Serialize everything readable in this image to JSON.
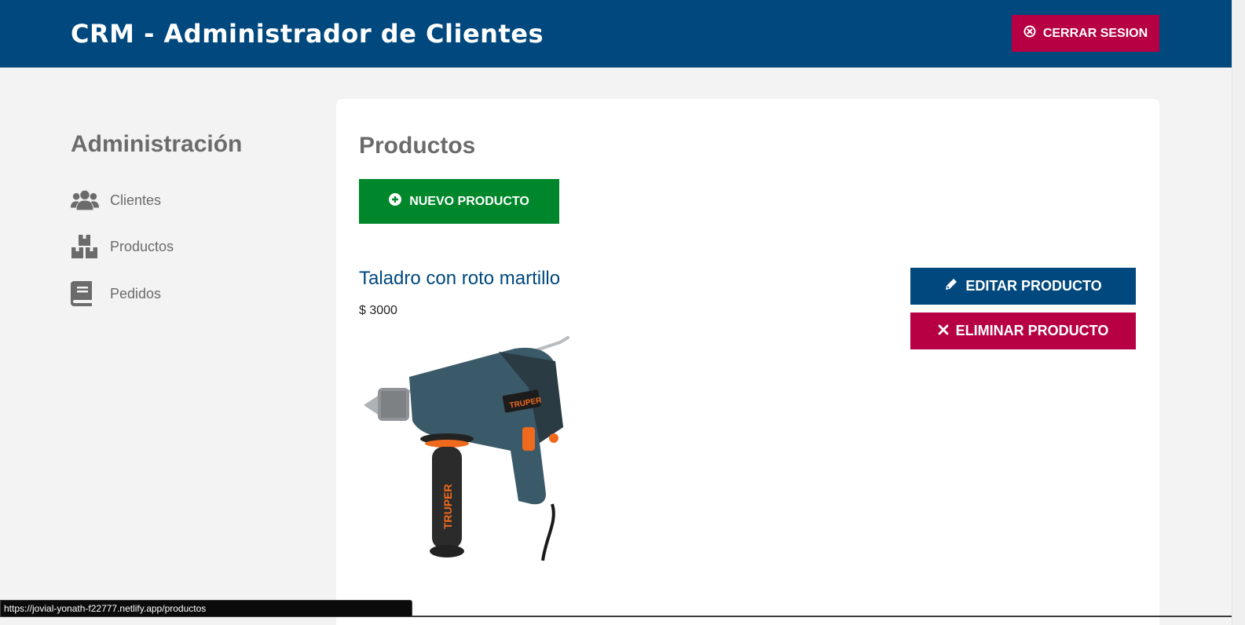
{
  "header": {
    "title": "CRM - Administrador de Clientes",
    "logout_label": "CERRAR SESION",
    "logout_icon": "x-circle-icon"
  },
  "sidebar": {
    "title": "Administración",
    "items": [
      {
        "label": "Clientes",
        "icon": "users-icon"
      },
      {
        "label": "Productos",
        "icon": "boxes-icon"
      },
      {
        "label": "Pedidos",
        "icon": "book-icon"
      }
    ]
  },
  "main": {
    "title": "Productos",
    "new_button_label": "NUEVO PRODUCTO",
    "product": {
      "name": "Taladro con roto martillo",
      "price": "$ 3000",
      "image_brand": "TRUPER"
    },
    "edit_label": "EDITAR PRODUCTO",
    "delete_label": "ELIMINAR PRODUCTO"
  },
  "status_url": "https://jovial-yonath-f22777.netlify.app/productos",
  "colors": {
    "header_bg": "#00487d",
    "danger": "#b60043",
    "success": "#00872b",
    "background": "#f3f3f3"
  }
}
